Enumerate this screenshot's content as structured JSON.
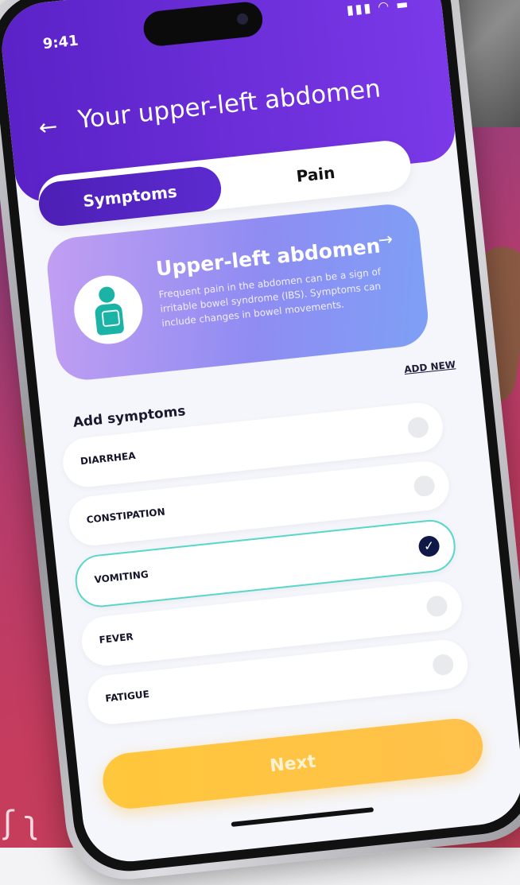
{
  "status_bar": {
    "time": "9:41",
    "signal": "▮▮▮ ◠ ▬"
  },
  "header": {
    "back_label": "←",
    "title": "Your upper-left abdomen"
  },
  "tabs": [
    {
      "label": "Symptoms",
      "active": true
    },
    {
      "label": "Pain",
      "active": false
    }
  ],
  "info_card": {
    "title": "Upper-left abdomen",
    "arrow": "→",
    "description": "Frequent pain in the abdomen can be a sign of irritable bowel syndrome (IBS). Symptoms can include changes in bowel movements."
  },
  "add_new_label": "ADD NEW",
  "add_symptoms_label": "Add symptoms",
  "symptoms": [
    {
      "label": "DIARRHEA",
      "checked": false
    },
    {
      "label": "CONSTIPATION",
      "checked": false
    },
    {
      "label": "VOMITING",
      "checked": true
    },
    {
      "label": "FEVER",
      "checked": false
    },
    {
      "label": "FATIGUE",
      "checked": false
    }
  ],
  "checkmark": "✓",
  "next_label": "Next",
  "colors": {
    "header": "#5a22c7",
    "accent_teal": "#58d6c8",
    "next_button": "#ffc73b",
    "check_on": "#101848"
  }
}
